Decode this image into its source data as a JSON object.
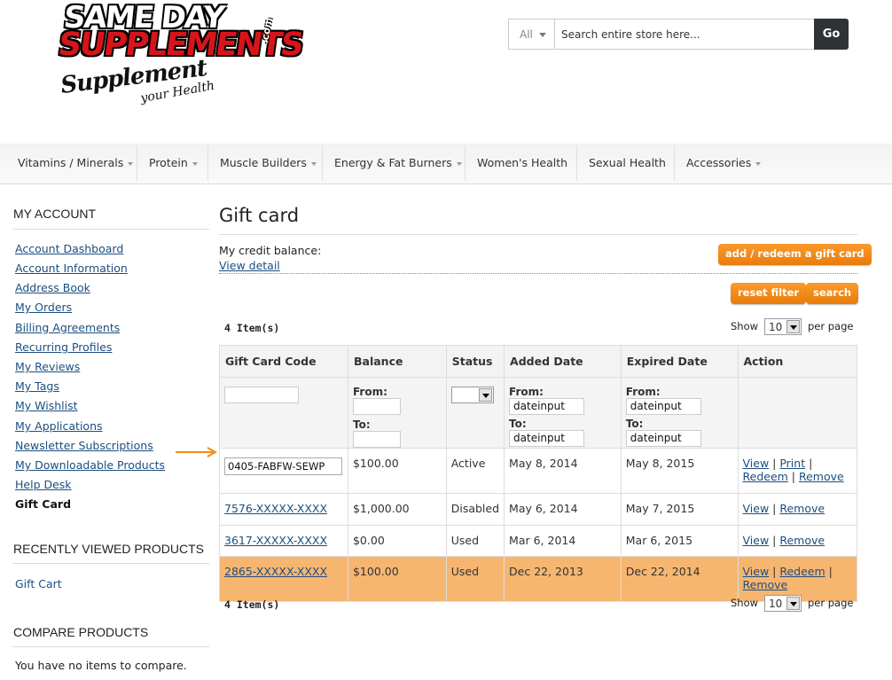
{
  "logo": {
    "line1": "SAME DAY",
    "line2": "SUPPLEMENTS",
    "suffix": ".com",
    "tagline1": "Supplement",
    "tagline2": "your Health"
  },
  "search": {
    "category": "All",
    "placeholder": "Search entire store here...",
    "button": "Go"
  },
  "nav": [
    {
      "label": "Vitamins / Minerals",
      "dropdown": true
    },
    {
      "label": "Protein",
      "dropdown": true
    },
    {
      "label": "Muscle Builders",
      "dropdown": true
    },
    {
      "label": "Energy & Fat Burners",
      "dropdown": true
    },
    {
      "label": "Women's Health",
      "dropdown": false
    },
    {
      "label": "Sexual Health",
      "dropdown": false
    },
    {
      "label": "Accessories",
      "dropdown": true
    }
  ],
  "sidebar": {
    "account_title": "MY ACCOUNT",
    "links": [
      "Account Dashboard",
      "Account Information",
      "Address Book",
      "My Orders",
      "Billing Agreements",
      "Recurring Profiles",
      "My Reviews",
      "My Tags",
      "My Wishlist",
      "My Applications",
      "Newsletter Subscriptions",
      "My Downloadable Products",
      "Help Desk"
    ],
    "current": "Gift Card",
    "recent_title": "RECENTLY VIEWED PRODUCTS",
    "recent_item": "Gift Cart",
    "compare_title": "COMPARE PRODUCTS",
    "compare_text": "You have no items to compare."
  },
  "main": {
    "title": "Gift card",
    "credit_label": "My credit balance:",
    "view_detail": "View detail",
    "add_button": "add / redeem a gift card",
    "reset_button": "reset filter",
    "search_button": "search",
    "count": "4 Item(s)",
    "show_label": "Show",
    "per_page_value": "10",
    "per_page_label": "per page"
  },
  "grid": {
    "headers": [
      "Gift Card Code",
      "Balance",
      "Status",
      "Added Date",
      "Expired Date",
      "Action"
    ],
    "filter": {
      "from": "From:",
      "to": "To:",
      "date_placeholder": "dateinput"
    },
    "rows": [
      {
        "code": "0405-FABFW-SEWP",
        "balance": "$100.00",
        "status": "Active",
        "added": "May 8, 2014",
        "expired": "May 8, 2015",
        "actions": [
          "View",
          "Print",
          "Redeem",
          "Remove"
        ]
      },
      {
        "code": "7576-XXXXX-XXXX",
        "balance": "$1,000.00",
        "status": "Disabled",
        "added": "May 6, 2014",
        "expired": "May 7, 2015",
        "actions": [
          "View",
          "Remove"
        ]
      },
      {
        "code": "3617-XXXXX-XXXX",
        "balance": "$0.00",
        "status": "Used",
        "added": "Mar 6, 2014",
        "expired": "Mar 6, 2015",
        "actions": [
          "View",
          "Remove"
        ]
      },
      {
        "code": "2865-XXXXX-XXXX",
        "balance": "$100.00",
        "status": "Used",
        "added": "Dec 22, 2013",
        "expired": "Dec 22, 2014",
        "actions": [
          "View",
          "Redeem",
          "Remove"
        ]
      }
    ]
  },
  "colors": {
    "accent": "#f08a1c",
    "highlight_row": "#f7b670",
    "link": "#1c4e80",
    "go_button": "#2e3336",
    "brand_red": "#d8141b"
  },
  "icons": {
    "arrow": "right-arrow-icon"
  }
}
